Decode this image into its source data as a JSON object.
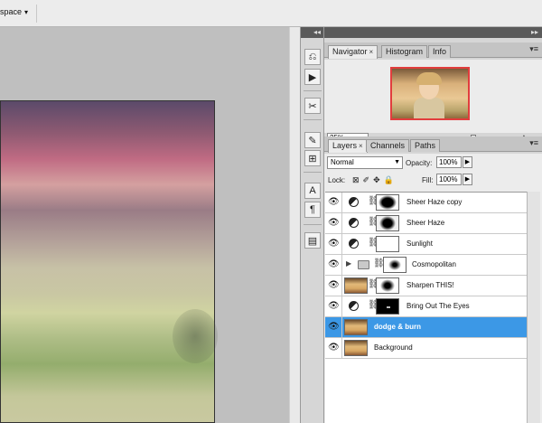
{
  "topbar": {
    "workspace_label": "space",
    "workspace_arrow": "▾"
  },
  "dock": {
    "header_glyph": "◂◂",
    "tool_icons": [
      "history-icon",
      "actions-icon",
      "tool-presets-icon",
      "brushes-icon",
      "clone-source-icon",
      "character-icon",
      "paragraph-icon",
      "layer-comps-icon"
    ]
  },
  "panels_header": {
    "glyph": "▸▸"
  },
  "navigator_group": {
    "tabs": [
      {
        "label": "Navigator",
        "active": true,
        "close": "×"
      },
      {
        "label": "Histogram",
        "active": false
      },
      {
        "label": "Info",
        "active": false
      }
    ],
    "menu_glyph": "▾≡",
    "zoom_value": "25%"
  },
  "layers_group": {
    "tabs": [
      {
        "label": "Layers",
        "active": true,
        "close": "×"
      },
      {
        "label": "Channels",
        "active": false
      },
      {
        "label": "Paths",
        "active": false
      }
    ],
    "menu_glyph": "▾≡",
    "blend_mode": "Normal",
    "opacity_label": "Opacity:",
    "opacity_value": "100%",
    "lock_label": "Lock:",
    "fill_label": "Fill:",
    "fill_value": "100%",
    "layers": [
      {
        "name": "Sheer Haze copy",
        "kind": "adjustment",
        "mask": "haze"
      },
      {
        "name": "Sheer Haze",
        "kind": "adjustment",
        "mask": "haze2"
      },
      {
        "name": "Sunlight",
        "kind": "adjustment",
        "mask": "white"
      },
      {
        "name": "Cosmopolitan",
        "kind": "group",
        "mask": "glow"
      },
      {
        "name": "Sharpen THIS!",
        "kind": "pixel-masked",
        "mask": "glow"
      },
      {
        "name": "Bring Out The Eyes",
        "kind": "adjustment",
        "mask": "eyes"
      },
      {
        "name": "dodge & burn",
        "kind": "pixel",
        "selected": true
      },
      {
        "name": "Background",
        "kind": "pixel"
      }
    ]
  },
  "colors": {
    "selection": "#3c98e6",
    "navigator_frame": "#e23d3d",
    "panel_bg": "#ececec",
    "panel_header": "#5a5a5a"
  }
}
